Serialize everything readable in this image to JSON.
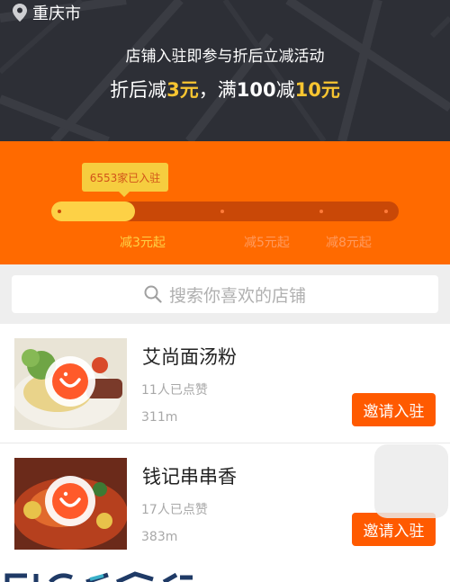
{
  "location": {
    "city": "重庆市",
    "icon": "location-pin-icon"
  },
  "promo": {
    "line1": "店铺入驻即参与折后立减活动",
    "line2_a": "折后减",
    "line2_b": "3元",
    "line2_c": "，满",
    "line2_d": "100",
    "line2_e": "减",
    "line2_f": "10元",
    "highlight_color": "#f7c531"
  },
  "progress": {
    "badge": "6553家已入驻",
    "fill_fraction": 0.24,
    "ticks": [
      {
        "label": "减3元起",
        "active": true
      },
      {
        "label": "减5元起",
        "active": false
      },
      {
        "label": "减8元起",
        "active": false
      }
    ],
    "colors": {
      "bg": "#ff6a00",
      "track": "#c94807",
      "fill": "#fdd146"
    }
  },
  "search": {
    "placeholder": "搜索你喜欢的店铺",
    "icon": "search-icon"
  },
  "stores": [
    {
      "name": "艾尚面汤粉",
      "likes": "11人已点赞",
      "distance": "311m",
      "button": "邀请入驻"
    },
    {
      "name": "钱记串串香",
      "likes": "17人已点赞",
      "distance": "383m",
      "button": "邀请入驻"
    }
  ],
  "accent": "#ff5a00"
}
